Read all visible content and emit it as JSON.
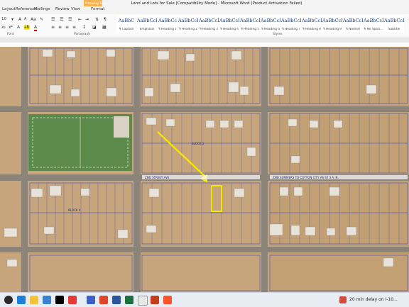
{
  "window": {
    "title": "Land and Lots for Sale [Compatibility Mode]  -  Microsoft Word (Product Activation Failed)",
    "context_tab": "Drawing Tools"
  },
  "ribbon_tabs": [
    "Layout",
    "References",
    "Mailings",
    "Review",
    "View",
    "Format"
  ],
  "home_ribbon": {
    "font_size": "10",
    "font_group_label": "Font",
    "paragraph_group_label": "Paragraph",
    "styles_group_label": "Styles"
  },
  "styles": [
    {
      "sample": "AaBbC",
      "name": "¶ Caption"
    },
    {
      "sample": "AaBbCcDc",
      "name": "Emphasis"
    },
    {
      "sample": "AaBbCc",
      "name": "¶ Heading 1"
    },
    {
      "sample": "AaBbCcI",
      "name": "¶ Heading 2"
    },
    {
      "sample": "AaBbCcI",
      "name": "¶ Heading 3"
    },
    {
      "sample": "AaBbCcI",
      "name": "¶ Heading 4"
    },
    {
      "sample": "AaBbCcI",
      "name": "¶ Heading 5"
    },
    {
      "sample": "AaBbCcDc",
      "name": "¶ Heading 6"
    },
    {
      "sample": "AaBbCcDc",
      "name": "¶ Heading 7"
    },
    {
      "sample": "AaBbCcDc",
      "name": "¶ Heading 8"
    },
    {
      "sample": "AaBbCcDc",
      "name": "¶ Heading 9"
    },
    {
      "sample": "AaBbCcDc",
      "name": "¶ Normal"
    },
    {
      "sample": "AaBbCcDd",
      "name": "¶ No Spaci..."
    },
    {
      "sample": "AaBbCcDc",
      "name": "Subtitle"
    }
  ],
  "map_labels": {
    "block_left": "BLOCK 4",
    "block_right": "BLOCK 3",
    "street_banner_right": "ZND SUMMERS TO COTTON CITY AS ST 3 A. N.",
    "street_banner_left": "ZND STREET AVE"
  },
  "taskbar": {
    "weather_text": "20 min delay on I-10..."
  }
}
